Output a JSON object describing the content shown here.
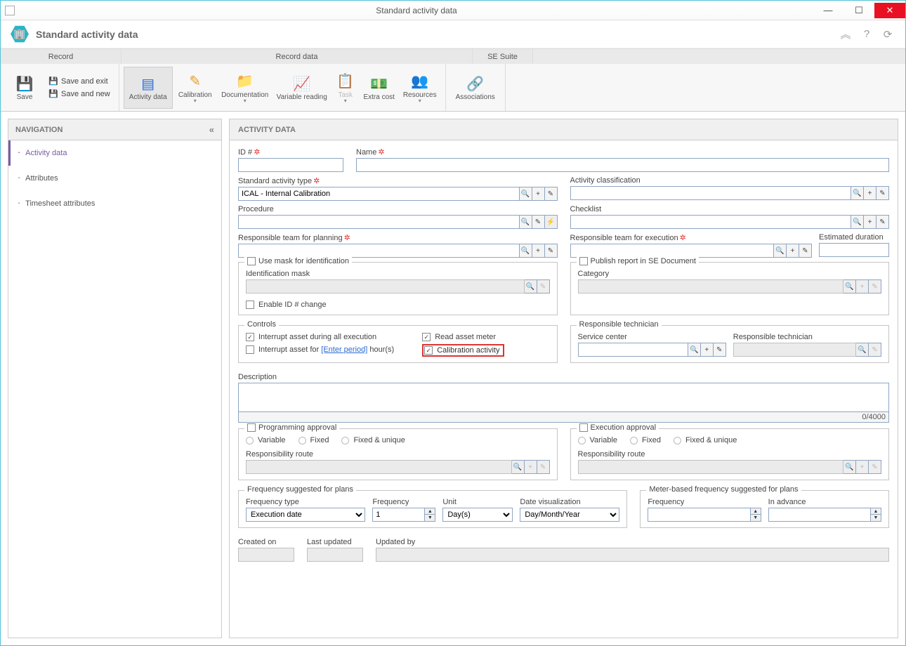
{
  "window": {
    "title": "Standard activity data"
  },
  "header": {
    "title": "Standard activity data"
  },
  "ribbon_tabs": {
    "record": "Record",
    "record_data": "Record data",
    "se_suite": "SE Suite"
  },
  "ribbon": {
    "save": "Save",
    "save_exit": "Save and exit",
    "save_new": "Save and new",
    "activity_data": "Activity data",
    "calibration": "Calibration",
    "documentation": "Documentation",
    "variable_reading": "Variable reading",
    "task": "Task",
    "extra_cost": "Extra cost",
    "resources": "Resources",
    "associations": "Associations"
  },
  "nav": {
    "title": "NAVIGATION",
    "items": [
      "Activity data",
      "Attributes",
      "Timesheet attributes"
    ]
  },
  "panel_title": "ACTIVITY DATA",
  "fields": {
    "id": "ID #",
    "name": "Name",
    "std_act_type": "Standard activity type",
    "std_act_type_val": "ICAL - Internal Calibration",
    "act_class": "Activity classification",
    "procedure": "Procedure",
    "checklist": "Checklist",
    "resp_team_plan": "Responsible team for planning",
    "resp_team_exec": "Responsible team for execution",
    "est_duration": "Estimated duration",
    "use_mask": "Use mask for identification",
    "ident_mask": "Identification mask",
    "enable_id_change": "Enable ID # change",
    "publish_report": "Publish report in SE Document",
    "category": "Category",
    "controls": "Controls",
    "interrupt_all": "Interrupt asset during all execution",
    "interrupt_for_pre": "Interrupt asset for ",
    "enter_period": "[Enter period]",
    "interrupt_for_post": " hour(s)",
    "read_meter": "Read asset meter",
    "calib_activity": "Calibration activity",
    "resp_tech": "Responsible technician",
    "service_center": "Service center",
    "resp_tech2": "Responsible technician",
    "description": "Description",
    "desc_count": "0/4000",
    "prog_approval": "Programming approval",
    "exec_approval": "Execution approval",
    "variable": "Variable",
    "fixed": "Fixed",
    "fixed_unique": "Fixed & unique",
    "resp_route": "Responsibility route",
    "freq_sugg": "Frequency suggested for plans",
    "freq_type": "Frequency type",
    "freq_type_val": "Execution date",
    "frequency": "Frequency",
    "freq_val": "1",
    "unit": "Unit",
    "unit_val": "Day(s)",
    "date_vis": "Date visualization",
    "date_vis_val": "Day/Month/Year",
    "meter_freq": "Meter-based frequency suggested for plans",
    "in_advance": "In advance",
    "created_on": "Created on",
    "last_updated": "Last updated",
    "updated_by": "Updated by"
  }
}
